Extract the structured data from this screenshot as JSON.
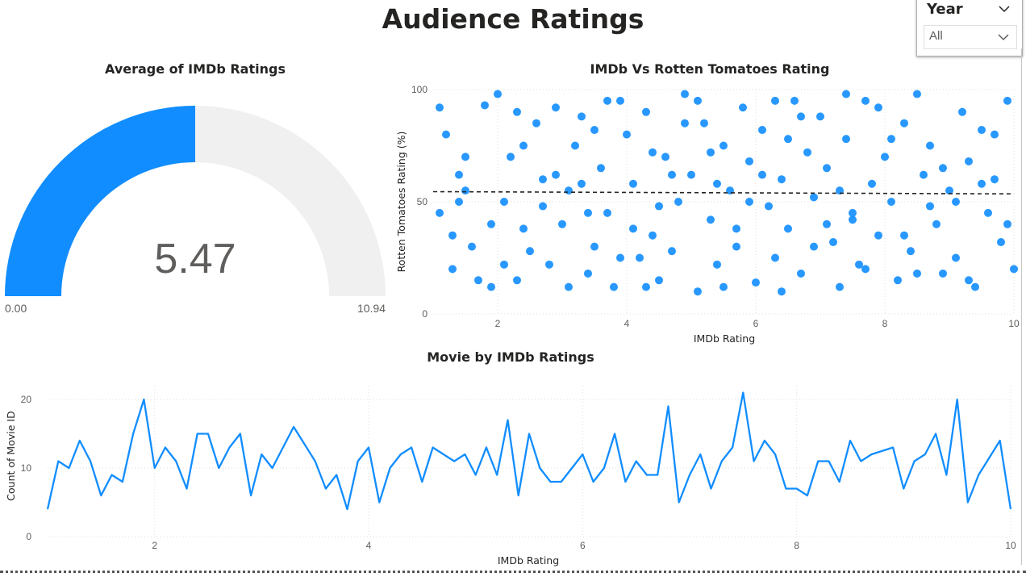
{
  "page_title": "Audience Ratings",
  "slicer": {
    "label": "Year",
    "value": "All"
  },
  "gauge": {
    "title": "Average of IMDb Ratings",
    "value": 5.47,
    "value_label": "5.47",
    "min_label": "0.00",
    "max_label": "10.94",
    "min": 0,
    "max": 10.94,
    "fill_color": "#118DFF",
    "track_color": "#F0F0F0"
  },
  "chart_data": [
    {
      "type": "scatter",
      "title": "IMDb Vs Rotten Tomatoes Rating",
      "xlabel": "IMDb Rating",
      "ylabel": "Rotten Tomatoes Rating (%)",
      "xlim": [
        1,
        10
      ],
      "ylim": [
        0,
        100
      ],
      "xticks": [
        "2",
        "4",
        "6",
        "8",
        "10"
      ],
      "yticks": [
        "0",
        "50",
        "100"
      ],
      "trend_line": {
        "style": "dashed",
        "y_at_xmin": 54.5,
        "y_at_xmax": 53.5
      },
      "color": "#118DFF",
      "note_points_approximate": true,
      "points": [
        [
          1.2,
          80
        ],
        [
          1.4,
          62
        ],
        [
          1.1,
          45
        ],
        [
          1.6,
          30
        ],
        [
          1.3,
          20
        ],
        [
          1.8,
          93
        ],
        [
          1.5,
          55
        ],
        [
          1.9,
          12
        ],
        [
          2.0,
          98
        ],
        [
          2.2,
          70
        ],
        [
          2.4,
          38
        ],
        [
          2.6,
          85
        ],
        [
          2.8,
          22
        ],
        [
          2.1,
          50
        ],
        [
          2.3,
          15
        ],
        [
          2.7,
          60
        ],
        [
          2.9,
          92
        ],
        [
          3.0,
          40
        ],
        [
          3.2,
          75
        ],
        [
          3.4,
          18
        ],
        [
          3.1,
          55
        ],
        [
          3.3,
          88
        ],
        [
          3.5,
          30
        ],
        [
          3.6,
          65
        ],
        [
          3.8,
          12
        ],
        [
          3.9,
          95
        ],
        [
          3.7,
          45
        ],
        [
          4.0,
          80
        ],
        [
          4.2,
          25
        ],
        [
          4.1,
          58
        ],
        [
          4.3,
          90
        ],
        [
          4.4,
          35
        ],
        [
          4.6,
          70
        ],
        [
          4.5,
          15
        ],
        [
          4.8,
          50
        ],
        [
          4.9,
          98
        ],
        [
          4.7,
          28
        ],
        [
          5.0,
          62
        ],
        [
          5.2,
          85
        ],
        [
          5.1,
          10
        ],
        [
          5.3,
          42
        ],
        [
          5.5,
          75
        ],
        [
          5.4,
          22
        ],
        [
          5.6,
          55
        ],
        [
          5.8,
          92
        ],
        [
          5.7,
          30
        ],
        [
          5.9,
          68
        ],
        [
          6.0,
          14
        ],
        [
          6.2,
          48
        ],
        [
          6.1,
          82
        ],
        [
          6.3,
          25
        ],
        [
          6.4,
          60
        ],
        [
          6.6,
          95
        ],
        [
          6.5,
          38
        ],
        [
          6.8,
          72
        ],
        [
          6.7,
          18
        ],
        [
          6.9,
          52
        ],
        [
          7.0,
          88
        ],
        [
          7.2,
          32
        ],
        [
          7.1,
          65
        ],
        [
          7.3,
          12
        ],
        [
          7.5,
          45
        ],
        [
          7.4,
          78
        ],
        [
          7.6,
          22
        ],
        [
          7.8,
          58
        ],
        [
          7.7,
          95
        ],
        [
          7.9,
          35
        ],
        [
          8.0,
          70
        ],
        [
          8.2,
          15
        ],
        [
          8.1,
          50
        ],
        [
          8.3,
          85
        ],
        [
          8.4,
          28
        ],
        [
          8.6,
          62
        ],
        [
          8.5,
          98
        ],
        [
          8.8,
          40
        ],
        [
          8.7,
          75
        ],
        [
          8.9,
          18
        ],
        [
          9.0,
          55
        ],
        [
          9.2,
          90
        ],
        [
          9.1,
          25
        ],
        [
          9.3,
          68
        ],
        [
          9.4,
          12
        ],
        [
          9.6,
          45
        ],
        [
          9.5,
          82
        ],
        [
          9.8,
          32
        ],
        [
          9.7,
          60
        ],
        [
          9.9,
          95
        ],
        [
          10.0,
          20
        ],
        [
          1.5,
          70
        ],
        [
          2.5,
          28
        ],
        [
          3.5,
          82
        ],
        [
          4.5,
          48
        ],
        [
          5.5,
          12
        ],
        [
          6.5,
          78
        ],
        [
          7.5,
          42
        ],
        [
          8.5,
          18
        ],
        [
          9.5,
          58
        ],
        [
          1.9,
          40
        ],
        [
          2.9,
          62
        ],
        [
          3.9,
          25
        ],
        [
          4.9,
          85
        ],
        [
          5.9,
          50
        ],
        [
          6.9,
          30
        ],
        [
          7.9,
          92
        ],
        [
          8.9,
          65
        ],
        [
          9.9,
          40
        ],
        [
          1.3,
          35
        ],
        [
          2.3,
          90
        ],
        [
          3.3,
          58
        ],
        [
          4.3,
          12
        ],
        [
          5.3,
          72
        ],
        [
          6.3,
          95
        ],
        [
          7.3,
          55
        ],
        [
          8.3,
          35
        ],
        [
          9.3,
          15
        ],
        [
          1.7,
          15
        ],
        [
          2.7,
          48
        ],
        [
          3.7,
          95
        ],
        [
          4.7,
          62
        ],
        [
          5.7,
          38
        ],
        [
          6.7,
          88
        ],
        [
          7.7,
          20
        ],
        [
          8.7,
          48
        ],
        [
          9.7,
          80
        ],
        [
          1.1,
          92
        ],
        [
          2.1,
          22
        ],
        [
          3.1,
          12
        ],
        [
          4.1,
          38
        ],
        [
          5.1,
          95
        ],
        [
          6.1,
          62
        ],
        [
          7.1,
          40
        ],
        [
          8.1,
          78
        ],
        [
          9.1,
          50
        ],
        [
          1.4,
          50
        ],
        [
          2.4,
          75
        ],
        [
          3.4,
          45
        ],
        [
          4.4,
          72
        ],
        [
          5.4,
          58
        ],
        [
          6.4,
          10
        ],
        [
          7.4,
          98
        ]
      ]
    },
    {
      "type": "line",
      "title": "Movie by IMDb Ratings",
      "xlabel": "IMDb Rating",
      "ylabel": "Count of Movie ID",
      "xlim": [
        1,
        10
      ],
      "ylim": [
        0,
        22
      ],
      "xticks": [
        "2",
        "4",
        "6",
        "8",
        "10"
      ],
      "yticks": [
        "0",
        "10",
        "20"
      ],
      "color": "#118DFF",
      "x": [
        1.0,
        1.1,
        1.2,
        1.3,
        1.4,
        1.5,
        1.6,
        1.7,
        1.8,
        1.9,
        2.0,
        2.1,
        2.2,
        2.3,
        2.4,
        2.5,
        2.6,
        2.7,
        2.8,
        2.9,
        3.0,
        3.1,
        3.3,
        3.5,
        3.6,
        3.7,
        3.8,
        3.9,
        4.0,
        4.1,
        4.2,
        4.3,
        4.4,
        4.5,
        4.6,
        4.8,
        4.9,
        5.0,
        5.1,
        5.2,
        5.3,
        5.4,
        5.5,
        5.6,
        5.7,
        5.8,
        6.0,
        6.1,
        6.2,
        6.3,
        6.4,
        6.5,
        6.6,
        6.7,
        6.8,
        6.9,
        7.0,
        7.1,
        7.2,
        7.3,
        7.4,
        7.5,
        7.6,
        7.7,
        7.8,
        7.9,
        8.0,
        8.1,
        8.2,
        8.3,
        8.4,
        8.5,
        8.6,
        8.7,
        8.9,
        9.0,
        9.1,
        9.2,
        9.3,
        9.4,
        9.5,
        9.6,
        9.7,
        9.9,
        10.0
      ],
      "values": [
        4,
        11,
        10,
        14,
        11,
        6,
        9,
        8,
        15,
        20,
        10,
        13,
        11,
        7,
        15,
        15,
        10,
        13,
        15,
        6,
        12,
        10,
        16,
        11,
        7,
        9,
        4,
        11,
        13,
        5,
        10,
        12,
        13,
        8,
        13,
        11,
        12,
        9,
        13,
        9,
        17,
        6,
        15,
        10,
        8,
        8,
        12,
        8,
        10,
        15,
        8,
        11,
        9,
        9,
        19,
        5,
        9,
        12,
        7,
        11,
        13,
        21,
        11,
        14,
        12,
        7,
        7,
        6,
        11,
        11,
        8,
        14,
        11,
        12,
        13,
        7,
        11,
        12,
        15,
        9,
        20,
        5,
        9,
        14,
        4
      ]
    }
  ]
}
